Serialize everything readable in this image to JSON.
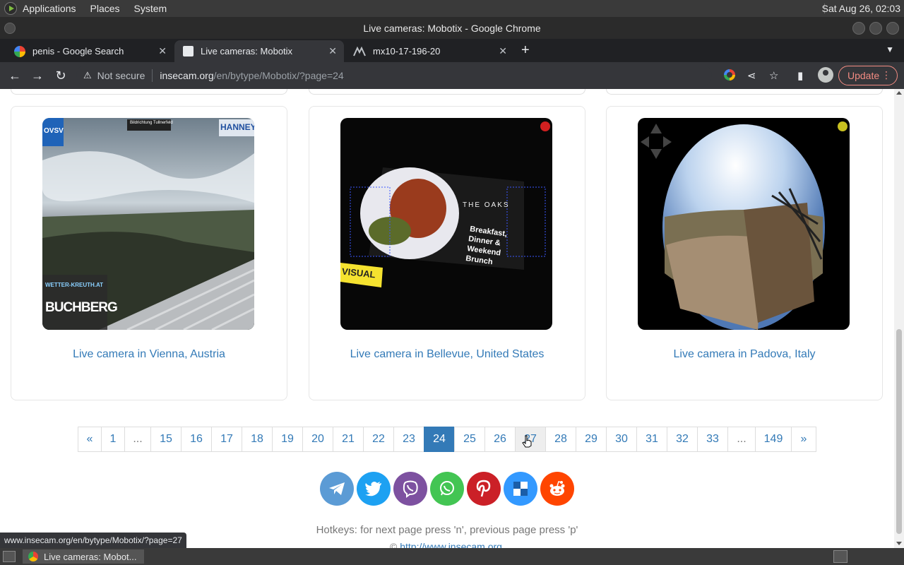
{
  "panel": {
    "menus": [
      "Applications",
      "Places",
      "System"
    ],
    "clock": "Sat Aug 26, 02:03"
  },
  "window": {
    "title": "Live cameras: Mobotix - Google Chrome"
  },
  "tabs": [
    {
      "label": "penis - Google Search",
      "favicon": "google-icon"
    },
    {
      "label": "Live cameras: Mobotix",
      "favicon": "insecam-icon"
    },
    {
      "label": "mx10-17-196-20",
      "favicon": "mobotix-icon"
    }
  ],
  "toolbar": {
    "security_label": "Not secure",
    "url_host": "insecam.org",
    "url_path": "/en/bytype/Mobotix/?page=24",
    "update_label": "Update"
  },
  "cameras": [
    {
      "caption": "Live camera in Vienna, Austria",
      "overlay_top_left": "OVSV",
      "overlay_top_center": "Bildrichtung Tullnerfeld",
      "overlay_top_right": "HANNEY",
      "overlay_site": "WETTER-KREUTH.AT",
      "overlay_name": "BUCHBERG"
    },
    {
      "caption": "Live camera in Bellevue, United States",
      "overlay_brand": "THE OAKS",
      "overlay_sign": "Breakfast, Dinner & Weekend Brunch",
      "overlay_visual": "VISUAL"
    },
    {
      "caption": "Live camera in Padova, Italy"
    }
  ],
  "pagination": {
    "items": [
      "«",
      "1",
      "...",
      "15",
      "16",
      "17",
      "18",
      "19",
      "20",
      "21",
      "22",
      "23",
      "24",
      "25",
      "26",
      "27",
      "28",
      "29",
      "30",
      "31",
      "32",
      "33",
      "...",
      "149",
      "»"
    ],
    "current": "24",
    "hovered": "27"
  },
  "share_buttons": [
    {
      "name": "telegram",
      "color": "#5b9bd5"
    },
    {
      "name": "twitter",
      "color": "#1da1f2"
    },
    {
      "name": "viber",
      "color": "#7d51a0"
    },
    {
      "name": "whatsapp",
      "color": "#43c553"
    },
    {
      "name": "pinterest",
      "color": "#cb2027"
    },
    {
      "name": "delicious",
      "color": "#3399ff"
    },
    {
      "name": "reddit",
      "color": "#ff4500"
    }
  ],
  "footer": {
    "hotkeys": "Hotkeys: for next page press 'n', previous page press 'p'",
    "copyright_symbol": "©",
    "copyright_link": "http://www.insecam.org"
  },
  "status_bar": {
    "url": "www.insecam.org/en/bytype/Mobotix/?page=27"
  },
  "taskbar": {
    "task_label": "Live cameras: Mobot..."
  }
}
